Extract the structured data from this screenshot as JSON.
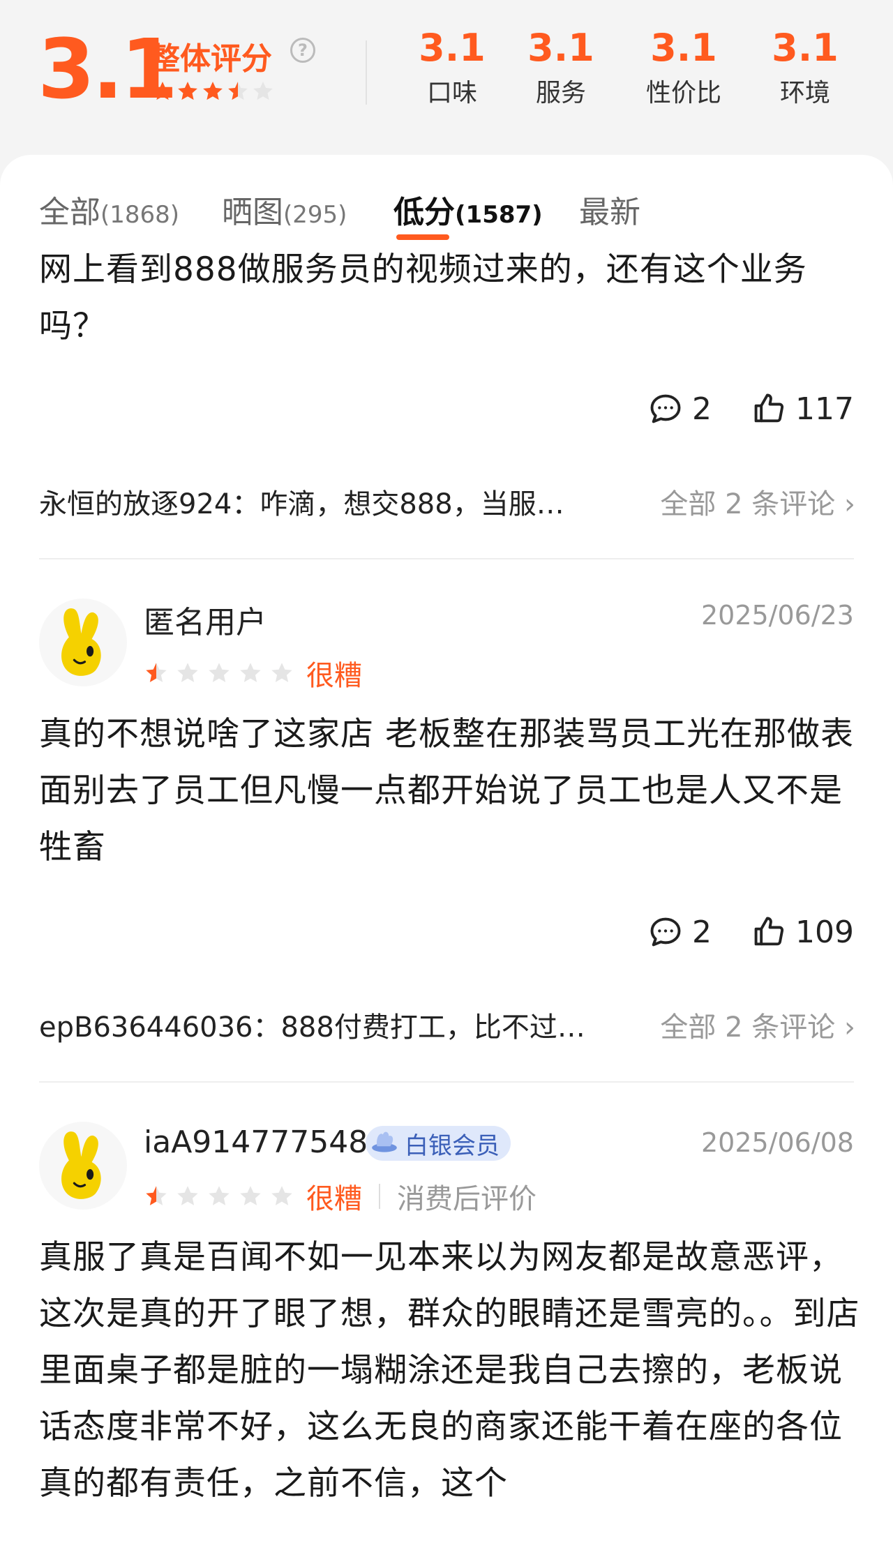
{
  "summary": {
    "overall_score": "3.1",
    "overall_label": "整体评分",
    "overall_stars": 3.5,
    "help_icon": "question-circle-icon",
    "subscores": [
      {
        "value": "3.1",
        "label": "口味"
      },
      {
        "value": "3.1",
        "label": "服务"
      },
      {
        "value": "3.1",
        "label": "性价比"
      },
      {
        "value": "3.1",
        "label": "环境"
      }
    ]
  },
  "tabs": [
    {
      "label": "全部",
      "count": "(1868)"
    },
    {
      "label": "晒图",
      "count": "(295)"
    },
    {
      "label": "低分",
      "count": "(1587)"
    },
    {
      "label": "最新",
      "count": ""
    }
  ],
  "active_tab": "低分",
  "reviews": [
    {
      "text": "网上看到888做服务员的视频过来的，还有这个业务吗？",
      "comment_count": "2",
      "like_count": "117",
      "reply_preview": "永恒的放逐924：咋滴，想交888，当服…",
      "reply_all": "全部 2 条评论"
    },
    {
      "username": "匿名用户",
      "date": "2025/06/23",
      "stars": 0.5,
      "rating_word": "很糟",
      "text": "真的不想说啥了这家店 老板整在那装骂员工光在那做表面别去了员工但凡慢一点都开始说了员工也是人又不是牲畜",
      "comment_count": "2",
      "like_count": "109",
      "reply_preview": "epB636446036：888付费打工，比不过…",
      "reply_all": "全部 2 条评论"
    },
    {
      "username": "iaA914777548",
      "badge": "白银会员",
      "date": "2025/06/08",
      "stars": 0.5,
      "rating_word": "很糟",
      "consume_label": "消费后评价",
      "text": "真服了真是百闻不如一见本来以为网友都是故意恶评，这次是真的开了眼了想，群众的眼睛还是雪亮的。。到店里面桌子都是脏的一塌糊涂还是我自己去擦的，老板说话态度非常不好，这么无良的商家还能干着在座的各位真的都有责任，之前不信，这个"
    }
  ],
  "colors": {
    "accent": "#ff5a1f",
    "star_empty": "#e5e5e5",
    "badge_bg": "#dfe8fb",
    "badge_text": "#3b5fb8"
  }
}
